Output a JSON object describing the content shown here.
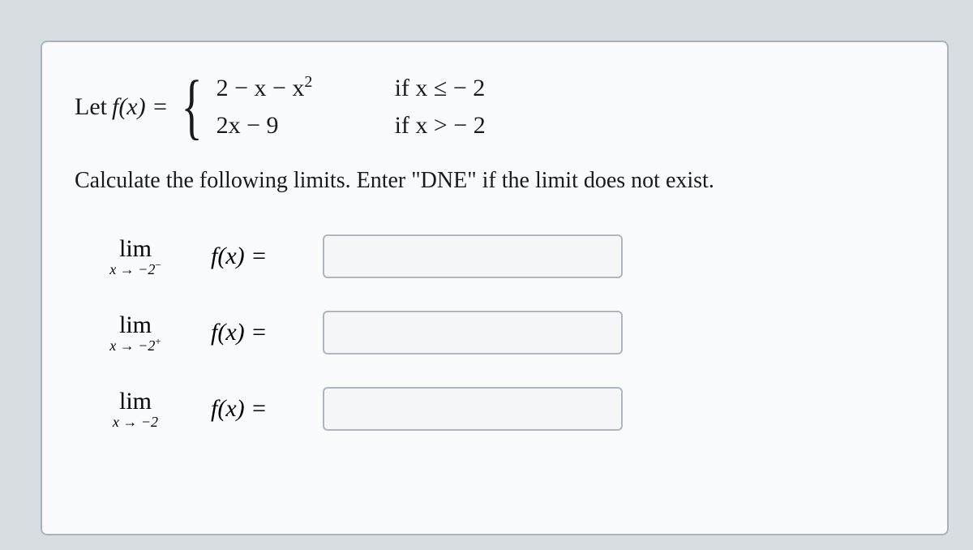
{
  "definition": {
    "let": "Let ",
    "func": "f(x) = ",
    "case1_expr": "2 − x − x",
    "case1_exp": "2",
    "case1_cond_pre": "if  x ≤  − 2",
    "case2_expr": "2x − 9",
    "case2_cond_pre": "if  x >  − 2"
  },
  "instruction": "Calculate the following limits. Enter \"DNE\" if the limit does not exist.",
  "limits": {
    "lim_word": "lim",
    "row1_sub": "x → −2",
    "row1_sup": "−",
    "row2_sub": "x → −2",
    "row2_sup": "+",
    "row3_sub": "x → −2",
    "row3_sup": "",
    "fx_eq": "f(x) = "
  },
  "answers": {
    "a1": "",
    "a2": "",
    "a3": ""
  }
}
